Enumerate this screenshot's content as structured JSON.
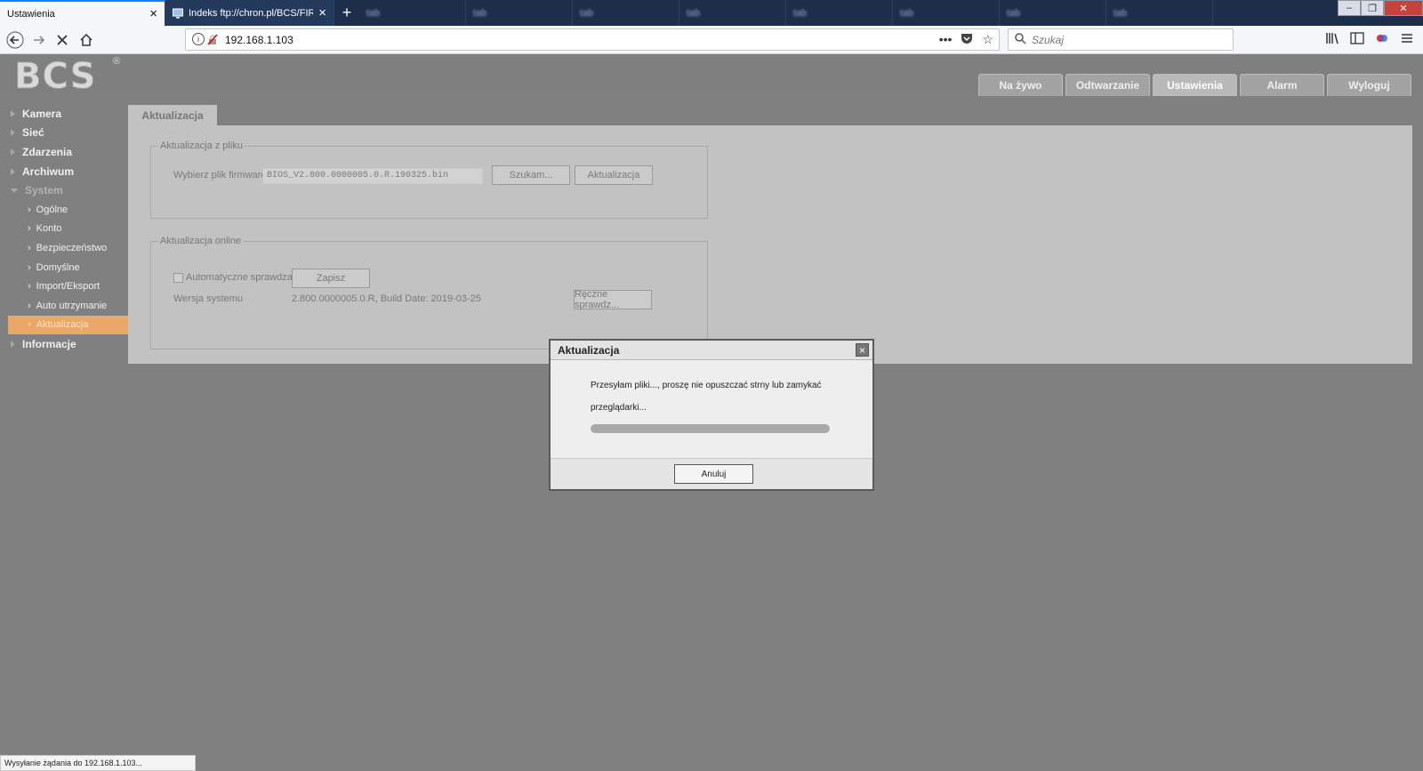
{
  "browser": {
    "tabs": [
      {
        "title": "Ustawienia",
        "active": true
      },
      {
        "title": "Indeks ftp://chron.pl/BCS/FIRM",
        "active": false
      }
    ],
    "blurred_tabs": [
      "tab",
      "tab",
      "tab",
      "tab",
      "tab",
      "tab",
      "tab",
      "tab",
      "tab"
    ],
    "new_tab_label": "+",
    "url": "192.168.1.103",
    "search_placeholder": "Szukaj",
    "status_text": "Wysyłanie żądania do 192.168.1.103..."
  },
  "app": {
    "logo": "BCS",
    "logo_mark": "®",
    "top_tabs": [
      {
        "label": "Na żywo",
        "active": false
      },
      {
        "label": "Odtwarzanie",
        "active": false
      },
      {
        "label": "Ustawienia",
        "active": true
      },
      {
        "label": "Alarm",
        "active": false
      },
      {
        "label": "Wyloguj",
        "active": false
      }
    ],
    "sidebar": {
      "sections": [
        {
          "label": "Kamera",
          "expanded": false
        },
        {
          "label": "Sieć",
          "expanded": false
        },
        {
          "label": "Zdarzenia",
          "expanded": false
        },
        {
          "label": "Archiwum",
          "expanded": false
        },
        {
          "label": "System",
          "expanded": true
        }
      ],
      "system_items": [
        {
          "label": "Ogólne",
          "selected": false
        },
        {
          "label": "Konto",
          "selected": false
        },
        {
          "label": "Bezpieczeństwo",
          "selected": false
        },
        {
          "label": "Domyślne",
          "selected": false
        },
        {
          "label": "Import/Eksport",
          "selected": false
        },
        {
          "label": "Auto utrzymanie",
          "selected": false
        },
        {
          "label": "Aktualizacja",
          "selected": true
        }
      ],
      "last_section": {
        "label": "Informacje"
      }
    },
    "content": {
      "tab_title": "Aktualizacja",
      "file_update": {
        "legend": "Aktualizacja z pliku",
        "choose_label": "Wybierz plik firmware",
        "file_value": "BIOS_V2.800.0000005.0.R.190325.bin",
        "browse_button": "Szukam...",
        "update_button": "Aktualizacja"
      },
      "online_update": {
        "legend": "Aktualizacja online",
        "auto_check_label": "Automatyczne sprawdza.",
        "auto_check_checked": false,
        "save_button": "Zapisz",
        "version_label": "Wersja systemu",
        "version_value": "2.800.0000005.0.R, Build Date: 2019-03-25",
        "manual_check_button": "Ręczne sprawdz..."
      }
    },
    "modal": {
      "title": "Aktualizacja",
      "message_line1": "Przesyłam pliki..., proszę nie opuszczać strny lub zamykać",
      "message_line2": "przeglądarki...",
      "progress": 1.0,
      "cancel_button": "Anuluj"
    }
  }
}
